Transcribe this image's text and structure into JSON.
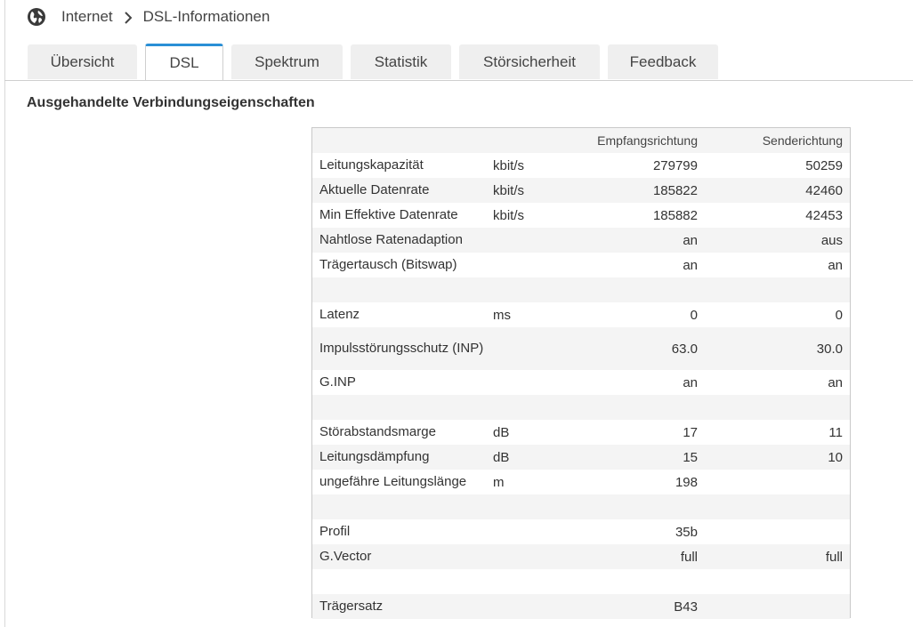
{
  "breadcrumb": {
    "root": "Internet",
    "current": "DSL-Informationen"
  },
  "tabs": [
    {
      "label": "Übersicht",
      "active": false
    },
    {
      "label": "DSL",
      "active": true
    },
    {
      "label": "Spektrum",
      "active": false
    },
    {
      "label": "Statistik",
      "active": false
    },
    {
      "label": "Störsicherheit",
      "active": false
    },
    {
      "label": "Feedback",
      "active": false
    }
  ],
  "section_title": "Ausgehandelte Verbindungseigenschaften",
  "table": {
    "headers": {
      "down": "Empfangsrichtung",
      "up": "Senderichtung"
    },
    "rows": [
      {
        "label": "Leitungskapazität",
        "unit": "kbit/s",
        "down": "279799",
        "up": "50259"
      },
      {
        "label": "Aktuelle Datenrate",
        "unit": "kbit/s",
        "down": "185822",
        "up": "42460"
      },
      {
        "label": "Min Effektive Datenrate",
        "unit": "kbit/s",
        "down": "185882",
        "up": "42453"
      },
      {
        "label": "Nahtlose Ratenadaption",
        "unit": "",
        "down": "an",
        "up": "aus"
      },
      {
        "label": "Trägertausch (Bitswap)",
        "unit": "",
        "down": "an",
        "up": "an"
      },
      {
        "label": "",
        "unit": "",
        "down": "",
        "up": ""
      },
      {
        "label": "Latenz",
        "unit": "ms",
        "down": "0",
        "up": "0"
      },
      {
        "label": "Impulsstörungsschutz (INP)",
        "unit": "",
        "down": "63.0",
        "up": "30.0"
      },
      {
        "label": "G.INP",
        "unit": "",
        "down": "an",
        "up": "an"
      },
      {
        "label": "",
        "unit": "",
        "down": "",
        "up": ""
      },
      {
        "label": "Störabstandsmarge",
        "unit": "dB",
        "down": "17",
        "up": "11"
      },
      {
        "label": "Leitungsdämpfung",
        "unit": "dB",
        "down": "15",
        "up": "10"
      },
      {
        "label": "ungefähre Leitungslänge",
        "unit": "m",
        "down": "198",
        "up": ""
      },
      {
        "label": "",
        "unit": "",
        "down": "",
        "up": ""
      },
      {
        "label": "Profil",
        "unit": "",
        "down": "35b",
        "up": ""
      },
      {
        "label": "G.Vector",
        "unit": "",
        "down": "full",
        "up": "full"
      },
      {
        "label": "",
        "unit": "",
        "down": "",
        "up": ""
      },
      {
        "label": "Trägersatz",
        "unit": "",
        "down": "B43",
        "up": ""
      }
    ]
  },
  "colors": {
    "accent": "#2a8fd6",
    "tab_bg": "#efefef",
    "row_alt": "#f4f4f4",
    "border": "#c9c9c9"
  },
  "icons": {
    "breadcrumb_root": "globe-icon",
    "separator": "chevron-right-icon"
  }
}
